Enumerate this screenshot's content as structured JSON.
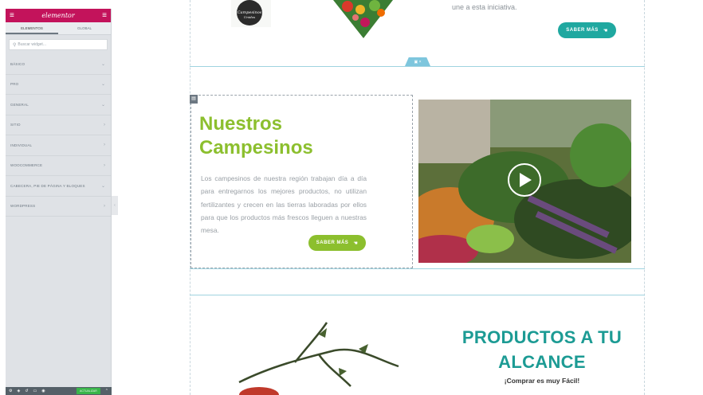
{
  "sidebar": {
    "logo": "elementor",
    "tabs": [
      "ELEMENTOS",
      "GLOBAL"
    ],
    "search_placeholder": "Buscar widget...",
    "categories": [
      {
        "label": "BÁSICO",
        "chevron": "⌄"
      },
      {
        "label": "PRO",
        "chevron": "⌄"
      },
      {
        "label": "GENERAL",
        "chevron": "⌄"
      },
      {
        "label": "SITIO",
        "chevron": "›"
      },
      {
        "label": "INDIVIDUAL",
        "chevron": "›"
      },
      {
        "label": "WOOCOMMERCE",
        "chevron": "›"
      },
      {
        "label": "CABECERA, PIE DE PÁGINA Y BLOQUES",
        "chevron": "⌄"
      },
      {
        "label": "WORDPRESS",
        "chevron": "›"
      }
    ],
    "footer_update": "ACTUALIZAR"
  },
  "top_section": {
    "text": "une a esta iniciativa.",
    "button": "SABER MÁS"
  },
  "campesinos": {
    "title": "Nuestros Campesinos",
    "text": "Los campesinos de nuestra región trabajan día a día para entregarnos los mejores productos, no utilizan fertilizantes y crecen en las tierras laboradas por ellos para que los productos más frescos lleguen a nuestras mesa.",
    "button": "SABER MÁS"
  },
  "productos": {
    "title": "PRODUCTOS A TU ALCANCE",
    "subtitle": "¡Comprar es muy Fácil!"
  },
  "colors": {
    "brand": "#c3135b",
    "green": "#8cbf2e",
    "teal": "#1fa8a0",
    "section_line": "#9fd3e0"
  }
}
